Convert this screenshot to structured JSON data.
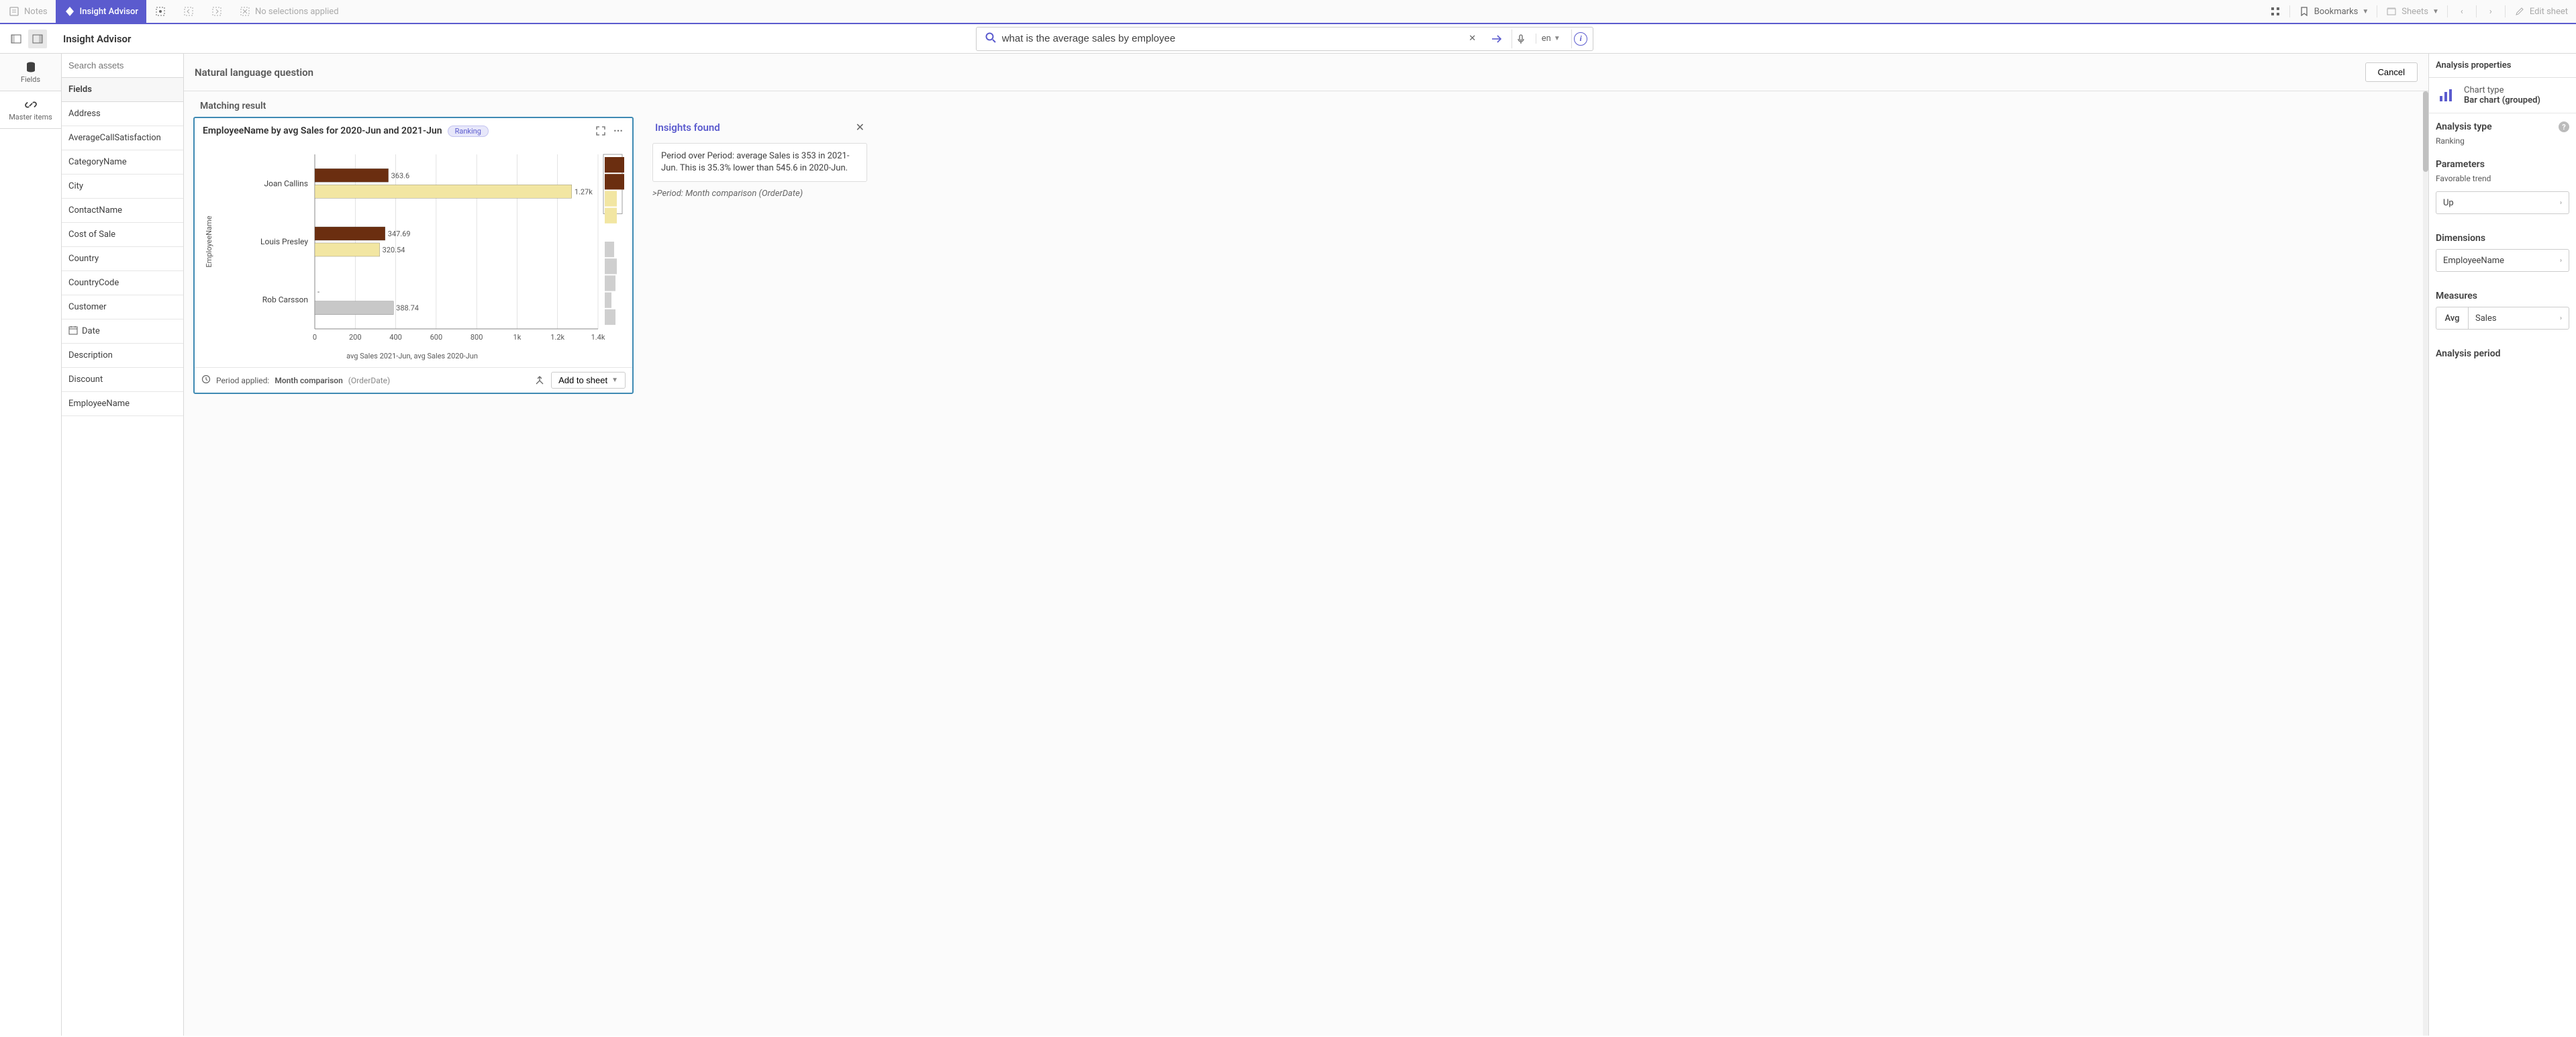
{
  "topbar": {
    "notes": "Notes",
    "insight_advisor": "Insight Advisor",
    "no_selections": "No selections applied",
    "bookmarks": "Bookmarks",
    "sheets": "Sheets",
    "edit_sheet": "Edit sheet"
  },
  "secondbar": {
    "title": "Insight Advisor",
    "search_value": "what is the average sales by employee",
    "lang": "en"
  },
  "rail": {
    "fields": "Fields",
    "master": "Master items"
  },
  "assets": {
    "search_placeholder": "Search assets",
    "header": "Fields",
    "items": [
      "Address",
      "AverageCallSatisfaction",
      "CategoryName",
      "City",
      "ContactName",
      "Cost of Sale",
      "Country",
      "CountryCode",
      "Customer",
      "Date",
      "Description",
      "Discount",
      "EmployeeName"
    ]
  },
  "center": {
    "nlq_title": "Natural language question",
    "cancel": "Cancel",
    "matching": "Matching result",
    "card_title": "EmployeeName by avg Sales for 2020-Jun and 2021-Jun",
    "rank_badge": "Ranking",
    "x_legend": "avg Sales 2021-Jun, avg Sales 2020-Jun",
    "y_label": "EmployeeName",
    "period_applied_label": "Period applied:",
    "period_applied_name": "Month comparison",
    "period_applied_paren": "(OrderDate)",
    "add_to_sheet": "Add to sheet"
  },
  "chart_data": {
    "type": "bar",
    "title": "EmployeeName by avg Sales for 2020-Jun and 2021-Jun",
    "ylabel": "EmployeeName",
    "xlabel": "avg Sales 2021-Jun, avg Sales 2020-Jun",
    "xlim": [
      0,
      1400
    ],
    "x_ticks": [
      0,
      200,
      400,
      600,
      800,
      "1k",
      "1.2k",
      "1.4k"
    ],
    "categories": [
      "Joan Callins",
      "Louis Presley",
      "Rob Carsson"
    ],
    "series": [
      {
        "name": "avg Sales 2021-Jun",
        "color": "#6b2e10",
        "values": [
          363.6,
          347.69,
          null
        ],
        "labels": [
          "363.6",
          "347.69",
          "-"
        ]
      },
      {
        "name": "avg Sales 2020-Jun",
        "color": "#f2e6a2",
        "values": [
          1270,
          320.54,
          388.74
        ],
        "labels": [
          "1.27k",
          "320.54",
          "388.74"
        ]
      }
    ],
    "minimap_bars": [
      30,
      30,
      18,
      18,
      0,
      14,
      18,
      16,
      10,
      16
    ]
  },
  "insights": {
    "title": "Insights found",
    "body": "Period over Period: average Sales is 353 in 2021-Jun. This is 35.3% lower than 545.6 in 2020-Jun.",
    "sub_prefix": ">",
    "sub": "Period: Month comparison (OrderDate)"
  },
  "right": {
    "header": "Analysis properties",
    "chart_type_label": "Chart type",
    "chart_type_value": "Bar chart (grouped)",
    "analysis_type_title": "Analysis type",
    "analysis_type_value": "Ranking",
    "parameters_title": "Parameters",
    "fav_trend": "Favorable trend",
    "fav_trend_value": "Up",
    "dimensions_title": "Dimensions",
    "dimension_value": "EmployeeName",
    "measures_title": "Measures",
    "measure_agg": "Avg",
    "measure_value": "Sales",
    "analysis_period_title": "Analysis period"
  }
}
